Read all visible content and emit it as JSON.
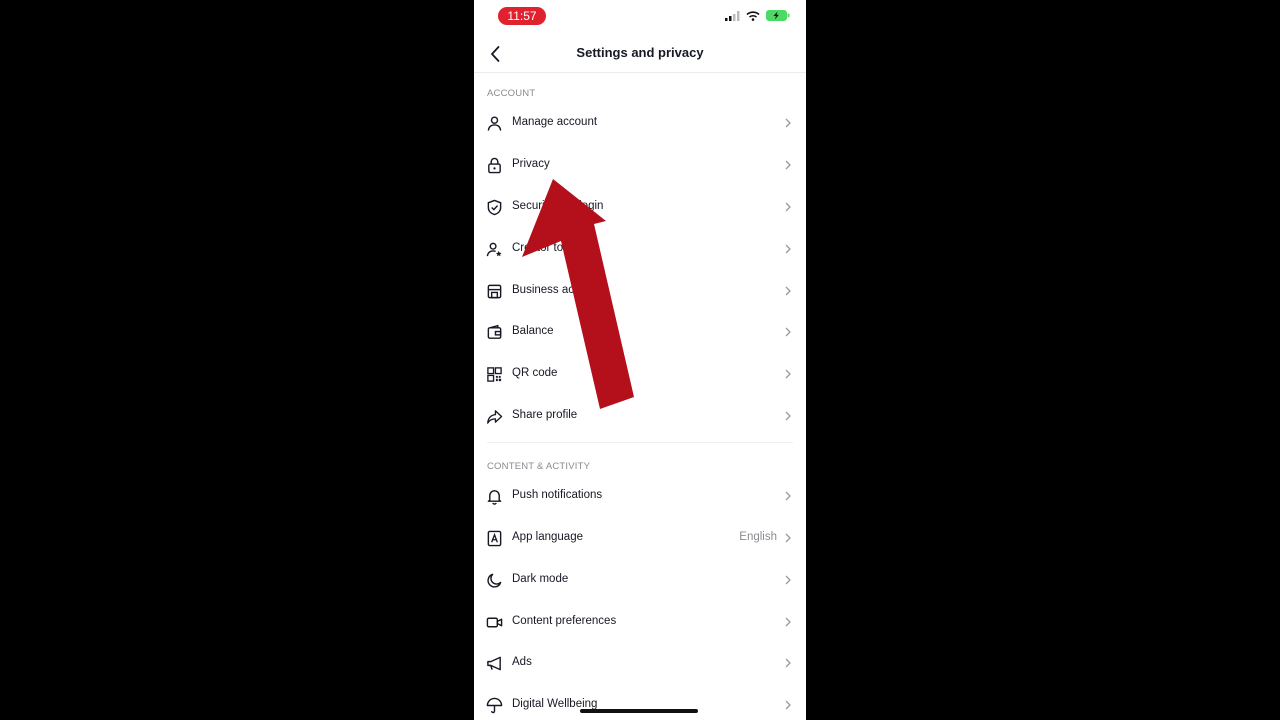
{
  "status_bar": {
    "time": "11:57",
    "time_pill_color": "#e0222f",
    "icons": [
      "cellular-signal-icon",
      "wifi-icon",
      "battery-charging-icon"
    ]
  },
  "header": {
    "title": "Settings and privacy",
    "back_icon": "back-chevron-icon"
  },
  "sections": {
    "account": {
      "header": "ACCOUNT",
      "items": [
        {
          "label": "Manage account",
          "icon": "person-icon"
        },
        {
          "label": "Privacy",
          "icon": "lock-icon"
        },
        {
          "label": "Security and login",
          "visible_label": "Secu… …gin",
          "icon": "shield-icon"
        },
        {
          "label": "Creator tools",
          "visible_label": "Creat…",
          "icon": "person-star-icon"
        },
        {
          "label": "Business account",
          "visible_label": "Busines…",
          "icon": "storefront-icon"
        },
        {
          "label": "Balance",
          "icon": "wallet-icon"
        },
        {
          "label": "QR code",
          "icon": "qr-code-icon"
        },
        {
          "label": "Share profile",
          "icon": "share-icon"
        }
      ]
    },
    "content_activity": {
      "header": "CONTENT & ACTIVITY",
      "items": [
        {
          "label": "Push notifications",
          "icon": "bell-icon"
        },
        {
          "label": "App language",
          "value": "English",
          "icon": "language-icon"
        },
        {
          "label": "Dark mode",
          "icon": "moon-icon"
        },
        {
          "label": "Content preferences",
          "icon": "video-icon"
        },
        {
          "label": "Ads",
          "icon": "megaphone-icon"
        },
        {
          "label": "Digital Wellbeing",
          "icon": "umbrella-icon"
        }
      ]
    }
  },
  "overlay": {
    "type": "annotation-arrow",
    "color": "#b3101c",
    "points_to": "Privacy"
  }
}
